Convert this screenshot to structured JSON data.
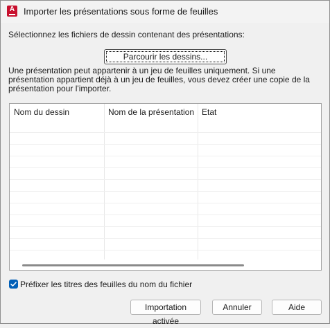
{
  "window": {
    "title": "Importer les présentations sous forme de feuilles",
    "app_icon": "autocad-icon",
    "app_icon_letter": "A"
  },
  "prompt": "Sélectionnez les fichiers de dessin contenant des présentations:",
  "browse_button": "Parcourir les dessins...",
  "info_text": "Une présentation peut appartenir à un jeu de feuilles uniquement. Si une présentation appartient déjà à un jeu de feuilles, vous devez créer une copie de la présentation pour l'importer.",
  "table": {
    "columns": [
      "Nom du dessin",
      "Nom de la présentation",
      "Etat"
    ],
    "rows": []
  },
  "prefix_option": {
    "label": "Préfixer les titres des feuilles du nom du fichier",
    "checked": true
  },
  "buttons": {
    "import": "Importation activée",
    "cancel": "Annuler",
    "help": "Aide"
  },
  "colors": {
    "accent": "#005fb8",
    "app_icon": "#c8102e"
  }
}
